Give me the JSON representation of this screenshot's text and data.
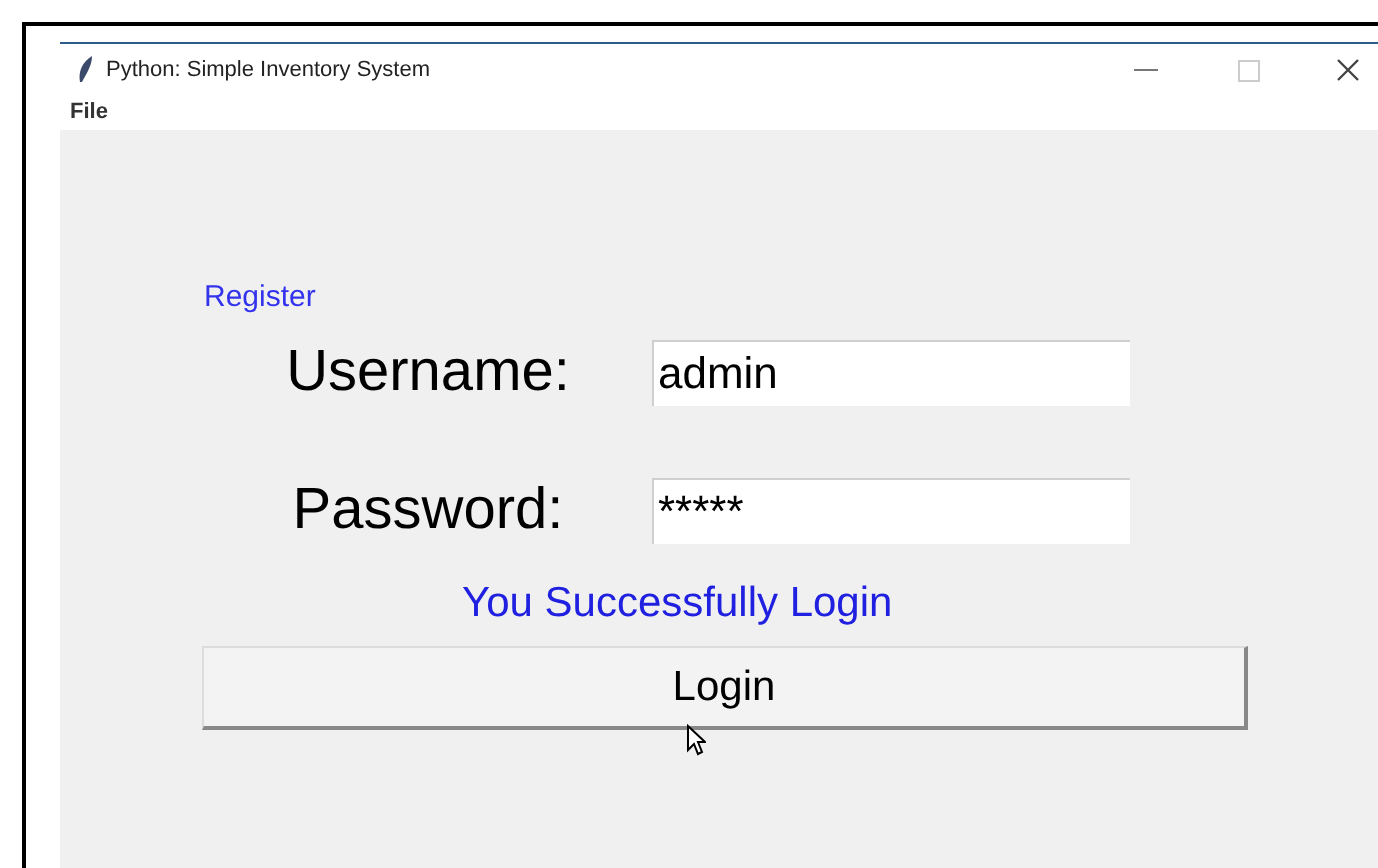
{
  "window": {
    "title": "Python: Simple Inventory System"
  },
  "menu": [
    "File"
  ],
  "register_link": "Register",
  "fields": [
    {
      "label": "Username:",
      "value": "admin"
    },
    {
      "label": "Password:",
      "value": "*****"
    }
  ],
  "message": "You Successfully Login",
  "login_button": "Login"
}
